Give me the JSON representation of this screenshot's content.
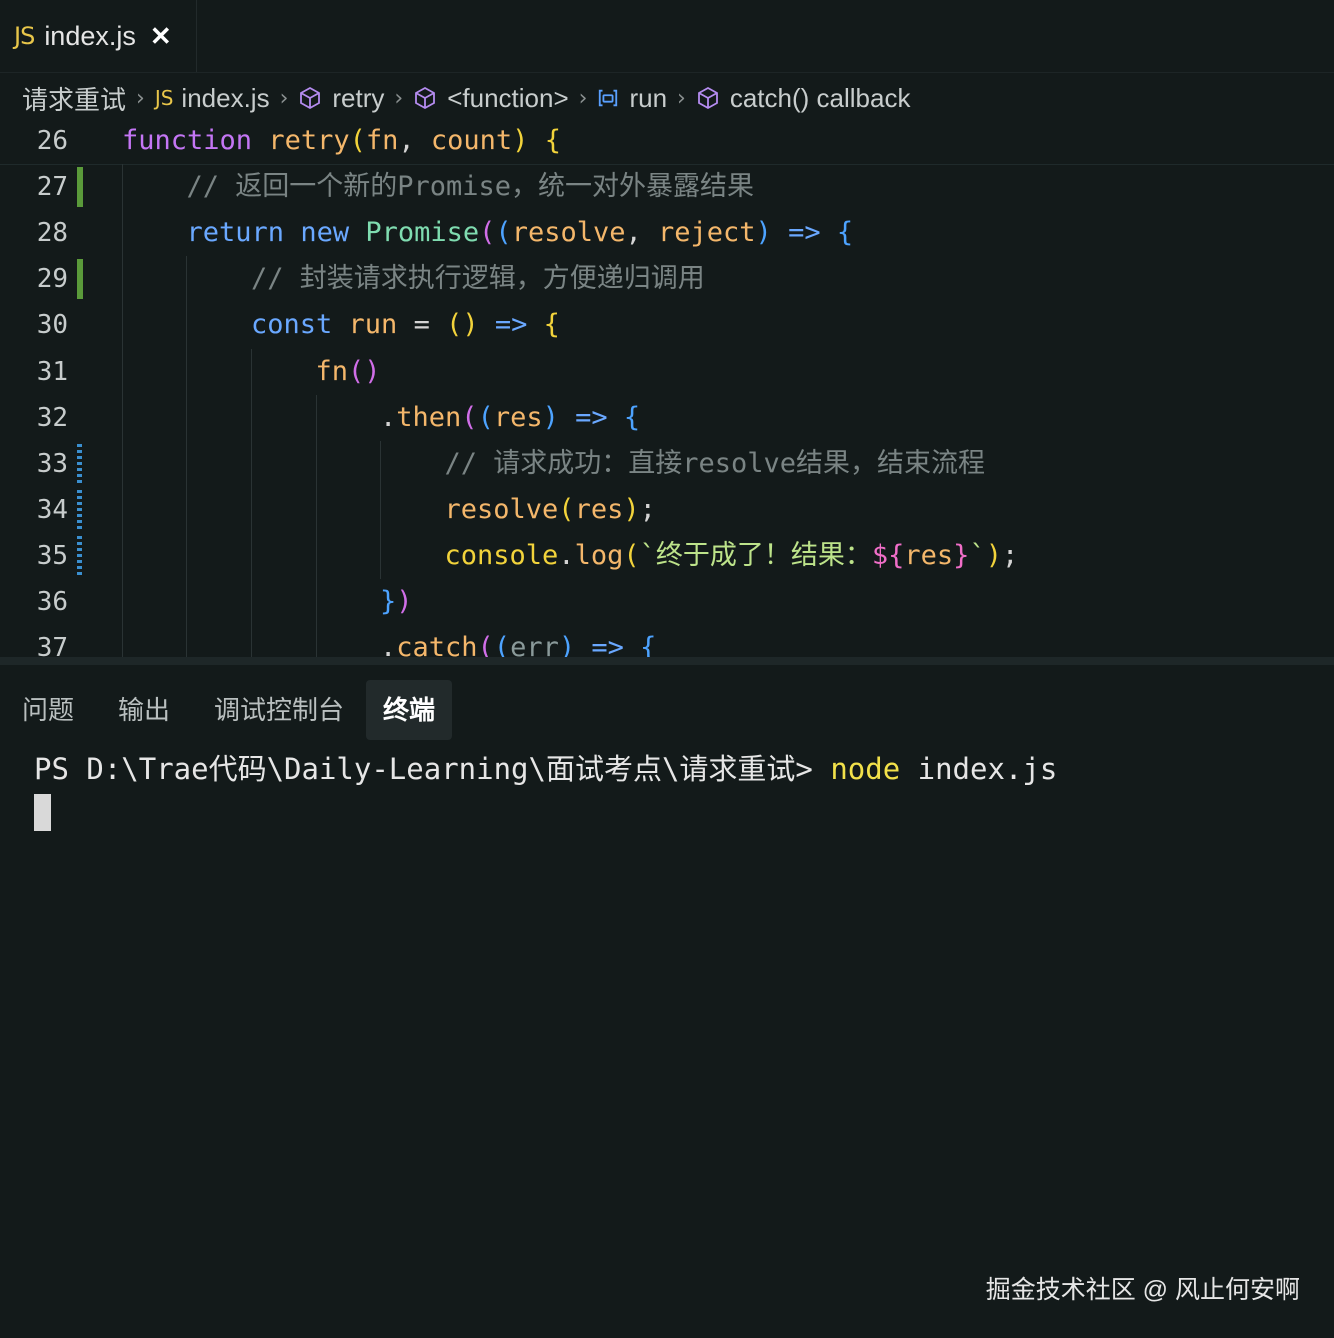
{
  "tab": {
    "icon": "JS",
    "name": "index.js",
    "close": "✕"
  },
  "breadcrumb": [
    {
      "label": "请求重试",
      "icon": "folder"
    },
    {
      "label": "index.js",
      "icon": "JS"
    },
    {
      "label": "retry",
      "icon": "cube-icon"
    },
    {
      "label": "<function>",
      "icon": "cube-icon"
    },
    {
      "label": "run",
      "icon": "variable-icon"
    },
    {
      "label": "catch() callback",
      "icon": "cube-icon"
    }
  ],
  "code_lines": [
    {
      "n": "26",
      "segments": [
        [
          "kw",
          "function"
        ],
        [
          "punc",
          " "
        ],
        [
          "fn",
          "retry"
        ],
        [
          "paren1",
          "("
        ],
        [
          "param",
          "fn"
        ],
        [
          "punc",
          ", "
        ],
        [
          "param",
          "count"
        ],
        [
          "paren1",
          ")"
        ],
        [
          "punc",
          " "
        ],
        [
          "paren1",
          "{"
        ]
      ]
    },
    {
      "n": "27",
      "segments": [
        [
          "comment",
          "// 返回一个新的Promise，统一对外暴露结果"
        ]
      ]
    },
    {
      "n": "28",
      "segments": [
        [
          "kw2",
          "return"
        ],
        [
          "punc",
          " "
        ],
        [
          "kw2",
          "new"
        ],
        [
          "punc",
          " "
        ],
        [
          "cls",
          "Promise"
        ],
        [
          "paren2",
          "("
        ],
        [
          "paren3",
          "("
        ],
        [
          "param",
          "resolve"
        ],
        [
          "punc",
          ", "
        ],
        [
          "param",
          "reject"
        ],
        [
          "paren3",
          ")"
        ],
        [
          "punc",
          " "
        ],
        [
          "kw2",
          "=>"
        ],
        [
          "punc",
          " "
        ],
        [
          "paren3",
          "{"
        ]
      ]
    },
    {
      "n": "29",
      "segments": [
        [
          "comment",
          "// 封装请求执行逻辑，方便递归调用"
        ]
      ]
    },
    {
      "n": "30",
      "segments": [
        [
          "kw2",
          "const"
        ],
        [
          "punc",
          " "
        ],
        [
          "fn",
          "run"
        ],
        [
          "punc",
          " = "
        ],
        [
          "paren1",
          "()"
        ],
        [
          "punc",
          " "
        ],
        [
          "kw2",
          "=>"
        ],
        [
          "punc",
          " "
        ],
        [
          "paren1",
          "{"
        ]
      ]
    },
    {
      "n": "31",
      "segments": [
        [
          "method",
          "fn"
        ],
        [
          "paren2",
          "()"
        ]
      ]
    },
    {
      "n": "32",
      "segments": [
        [
          "punc",
          "."
        ],
        [
          "method",
          "then"
        ],
        [
          "paren2",
          "("
        ],
        [
          "paren3",
          "("
        ],
        [
          "param",
          "res"
        ],
        [
          "paren3",
          ")"
        ],
        [
          "punc",
          " "
        ],
        [
          "kw2",
          "=>"
        ],
        [
          "punc",
          " "
        ],
        [
          "paren3",
          "{"
        ]
      ]
    },
    {
      "n": "33",
      "segments": [
        [
          "comment",
          "// 请求成功：直接resolve结果，结束流程"
        ]
      ]
    },
    {
      "n": "34",
      "segments": [
        [
          "method",
          "resolve"
        ],
        [
          "paren1",
          "("
        ],
        [
          "param",
          "res"
        ],
        [
          "paren1",
          ")"
        ],
        [
          "punc",
          ";"
        ]
      ]
    },
    {
      "n": "35",
      "segments": [
        [
          "obj",
          "console"
        ],
        [
          "punc",
          "."
        ],
        [
          "method",
          "log"
        ],
        [
          "paren1",
          "("
        ],
        [
          "str",
          "`终于成了！结果："
        ],
        [
          "tmpl",
          "${"
        ],
        [
          "param",
          "res"
        ],
        [
          "tmpl",
          "}"
        ],
        [
          "str",
          "`"
        ],
        [
          "paren1",
          ")"
        ],
        [
          "punc",
          ";"
        ]
      ]
    },
    {
      "n": "36",
      "segments": [
        [
          "paren3",
          "}"
        ],
        [
          "paren2",
          ")"
        ]
      ]
    },
    {
      "n": "37",
      "segments": [
        [
          "punc",
          "."
        ],
        [
          "method",
          "catch"
        ],
        [
          "paren2",
          "("
        ],
        [
          "paren3",
          "("
        ],
        [
          "dim",
          "err"
        ],
        [
          "paren3",
          ")"
        ],
        [
          "punc",
          " "
        ],
        [
          "kw2",
          "=>"
        ],
        [
          "punc",
          " "
        ],
        [
          "paren3",
          "{"
        ]
      ]
    }
  ],
  "panel_tabs": [
    "问题",
    "输出",
    "调试控制台",
    "终端"
  ],
  "active_panel_tab": "终端",
  "terminal": {
    "prompt": "PS D:\\Trae代码\\Daily-Learning\\面试考点\\请求重试> ",
    "command": "node",
    "args": " index.js"
  },
  "watermark": "掘金技术社区 @ 风止何安啊"
}
